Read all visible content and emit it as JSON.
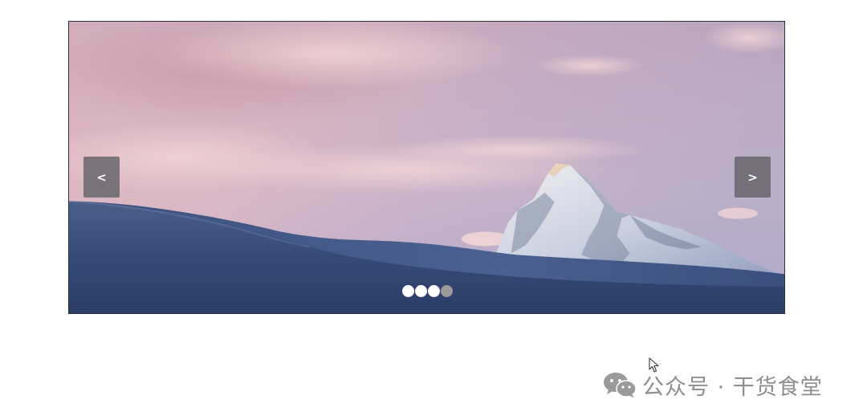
{
  "carousel": {
    "prev_label": "<",
    "next_label": ">",
    "slide_count": 4,
    "active_slide": 4,
    "slide_image": "mountain-peak-at-sunset"
  },
  "watermark": {
    "icon": "wechat-icon",
    "text": "公众号 · 干货食堂"
  },
  "colors": {
    "nav_button_bg": "#5f5f64",
    "dot_active": "#ffffff",
    "dot_inactive": "#9b9b9b",
    "watermark_text": "#8e8e8e"
  }
}
